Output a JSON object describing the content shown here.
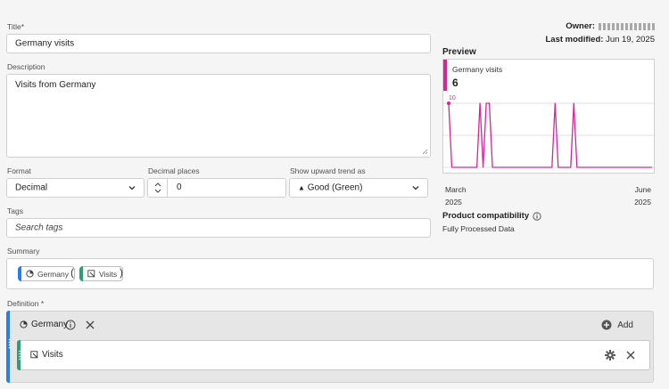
{
  "form": {
    "title_label": "Title",
    "title_required": "*",
    "title_value": "Germany visits",
    "description_label": "Description",
    "description_value": "Visits from Germany",
    "format_label": "Format",
    "format_value": "Decimal",
    "decimal_label": "Decimal places",
    "decimal_value": "0",
    "trend_label": "Show upward trend as",
    "trend_icon": "▲",
    "trend_value": "Good (Green)",
    "tags_label": "Tags",
    "tags_placeholder": "Search tags",
    "summary_label": "Summary",
    "definition_label": "Definition",
    "definition_required": "*"
  },
  "meta": {
    "owner_label": "Owner:",
    "modified_label": "Last modified:",
    "modified_value": "Jun 19, 2025"
  },
  "summary": {
    "segment_chip": "Germany",
    "paren_open": "(",
    "metric_chip": "Visits",
    "paren_close": ")"
  },
  "definition": {
    "segment_name": "Germany",
    "add_label": "Add",
    "metric_name": "Visits"
  },
  "preview": {
    "heading": "Preview",
    "metric_name": "Germany visits",
    "metric_value": "6",
    "compat_label": "Product compatibility",
    "compat_value": "Fully Processed Data"
  },
  "chart_data": {
    "type": "line",
    "ylim": [
      0,
      10
    ],
    "y_tick_labels": [
      "10"
    ],
    "x_tick_labels": [
      {
        "month": "March",
        "year": "2025"
      },
      {
        "month": "June",
        "year": "2025"
      }
    ],
    "series": [
      {
        "values": [
          10,
          0,
          0,
          0,
          0,
          0,
          0,
          0,
          0,
          0,
          10,
          0,
          10,
          10,
          0,
          0,
          0,
          0,
          0,
          0,
          0,
          0,
          0,
          0,
          0,
          0,
          0,
          0,
          0,
          0,
          0,
          0,
          0,
          0,
          10,
          0,
          0,
          0,
          0,
          0,
          10,
          0,
          0,
          0,
          0,
          0,
          0,
          0,
          0,
          0,
          0,
          0,
          0,
          0,
          0,
          0,
          0,
          0,
          0,
          0,
          0,
          0,
          0,
          0,
          0,
          0
        ]
      }
    ],
    "grid": true
  },
  "colors": {
    "accent_pink": "#d62598",
    "segment_blue": "#2680eb",
    "metric_green": "#2d9d78"
  },
  "icons": {
    "segment": "segment-icon",
    "metric": "metric-icon",
    "info": "info-icon",
    "close": "close-icon",
    "add": "add-circle-icon",
    "gear": "gear-icon",
    "chevron": "chevron-down-icon",
    "stepper": "stepper-icon"
  }
}
